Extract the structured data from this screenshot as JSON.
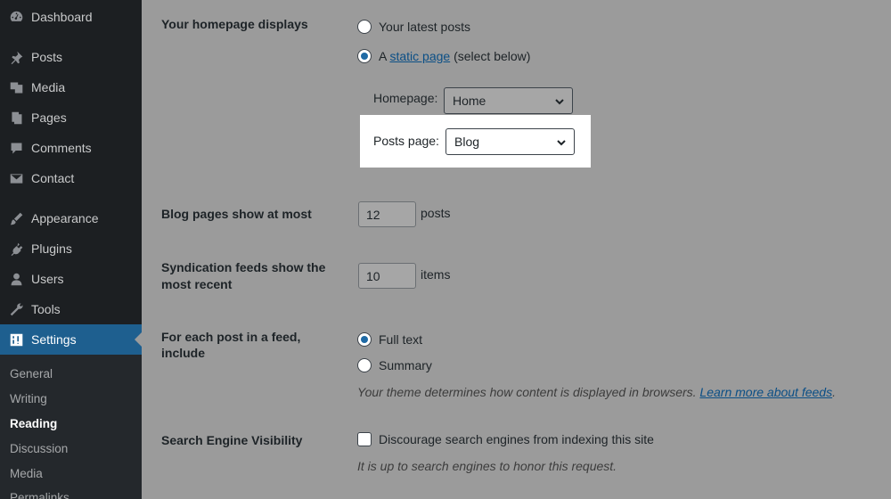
{
  "sidebar": {
    "items": [
      {
        "label": "Dashboard",
        "icon": "dashboard-icon"
      },
      {
        "label": "Posts",
        "icon": "pin-icon"
      },
      {
        "label": "Media",
        "icon": "media-icon"
      },
      {
        "label": "Pages",
        "icon": "pages-icon"
      },
      {
        "label": "Comments",
        "icon": "comments-icon"
      },
      {
        "label": "Contact",
        "icon": "mail-icon"
      },
      {
        "label": "Appearance",
        "icon": "brush-icon"
      },
      {
        "label": "Plugins",
        "icon": "plugin-icon"
      },
      {
        "label": "Users",
        "icon": "users-icon"
      },
      {
        "label": "Tools",
        "icon": "wrench-icon"
      },
      {
        "label": "Settings",
        "icon": "settings-icon",
        "active": true
      }
    ],
    "submenu": [
      {
        "label": "General"
      },
      {
        "label": "Writing"
      },
      {
        "label": "Reading",
        "current": true
      },
      {
        "label": "Discussion"
      },
      {
        "label": "Media"
      },
      {
        "label": "Permalinks"
      }
    ]
  },
  "reading": {
    "homepage_displays": {
      "label": "Your homepage displays",
      "option_latest": "Your latest posts",
      "option_static_prefix": "A",
      "option_static_link": "static page",
      "option_static_suffix": "(select below)",
      "selected": "static"
    },
    "homepage_select": {
      "label": "Homepage:",
      "value": "Home"
    },
    "posts_page_select": {
      "label": "Posts page:",
      "value": "Blog"
    },
    "blog_pages": {
      "label": "Blog pages show at most",
      "value": "12",
      "unit": "posts"
    },
    "syndication": {
      "label_line1": "Syndication feeds show the",
      "label_line2": "most recent",
      "value": "10",
      "unit": "items"
    },
    "feed_content": {
      "label_line1": "For each post in a feed,",
      "label_line2": "include",
      "option_full": "Full text",
      "option_summary": "Summary",
      "selected": "full",
      "description": "Your theme determines how content is displayed in browsers.",
      "link": "Learn more about feeds",
      "link_suffix": "."
    },
    "search_visibility": {
      "label": "Search Engine Visibility",
      "checkbox_label": "Discourage search engines from indexing this site",
      "checked": false,
      "description": "It is up to search engines to honor this request."
    }
  },
  "colors": {
    "sidebar_bg": "#1c1f22",
    "active_menu": "#1e5f8f",
    "radio_accent": "#1f6aa5",
    "link": "#0b4f86"
  }
}
